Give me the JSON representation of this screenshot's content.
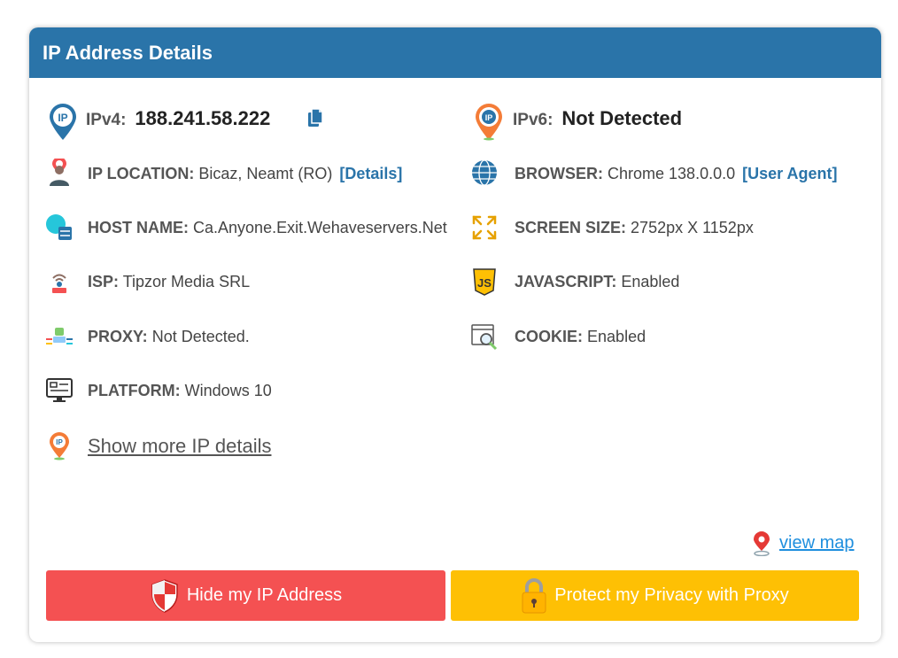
{
  "header": {
    "title": "IP Address Details"
  },
  "ipv4": {
    "label": "IPv4:",
    "value": "188.241.58.222"
  },
  "ipv6": {
    "label": "IPv6:",
    "value": "Not Detected"
  },
  "left": {
    "location": {
      "label": "IP LOCATION:",
      "value": "Bicaz, Neamt (RO)",
      "link": "[Details]"
    },
    "host": {
      "label": "HOST NAME:",
      "value": "Ca.Anyone.Exit.Wehaveservers.Net"
    },
    "isp": {
      "label": "ISP:",
      "value": "Tipzor Media SRL"
    },
    "proxy": {
      "label": "PROXY:",
      "value": "Not Detected."
    },
    "platform": {
      "label": "PLATFORM:",
      "value": "Windows 10"
    }
  },
  "right": {
    "browser": {
      "label": "BROWSER:",
      "value": "Chrome 138.0.0.0",
      "link": "[User Agent]"
    },
    "screen": {
      "label": "SCREEN SIZE:",
      "value": "2752px X 1152px"
    },
    "javascript": {
      "label": "JAVASCRIPT:",
      "value": "Enabled"
    },
    "cookie": {
      "label": "COOKIE:",
      "value": "Enabled"
    }
  },
  "show_more": "Show more IP details",
  "view_map": "view map",
  "buttons": {
    "hide_ip": "Hide my IP Address",
    "protect": "Protect my Privacy with Proxy"
  },
  "colors": {
    "header": "#2a74a9",
    "link": "#2a74a9",
    "hide_button": "#f45152",
    "protect_button": "#fec004",
    "view_map": "#1f8fde"
  },
  "icons": {
    "ipv4": "ip-pin-blue-icon",
    "ipv6": "ip-pin-orange-icon",
    "copy": "copy-icon",
    "location": "location-person-icon",
    "host": "server-globe-icon",
    "isp": "isp-router-icon",
    "proxy": "proxy-network-icon",
    "platform": "monitor-icon",
    "browser": "globe-icon",
    "screen": "expand-arrows-icon",
    "javascript": "js-shield-icon",
    "cookie": "cookie-search-icon",
    "show_more": "ip-pin-icon",
    "view_map": "map-pin-icon",
    "hide": "shield-icon",
    "protect": "padlock-icon"
  }
}
